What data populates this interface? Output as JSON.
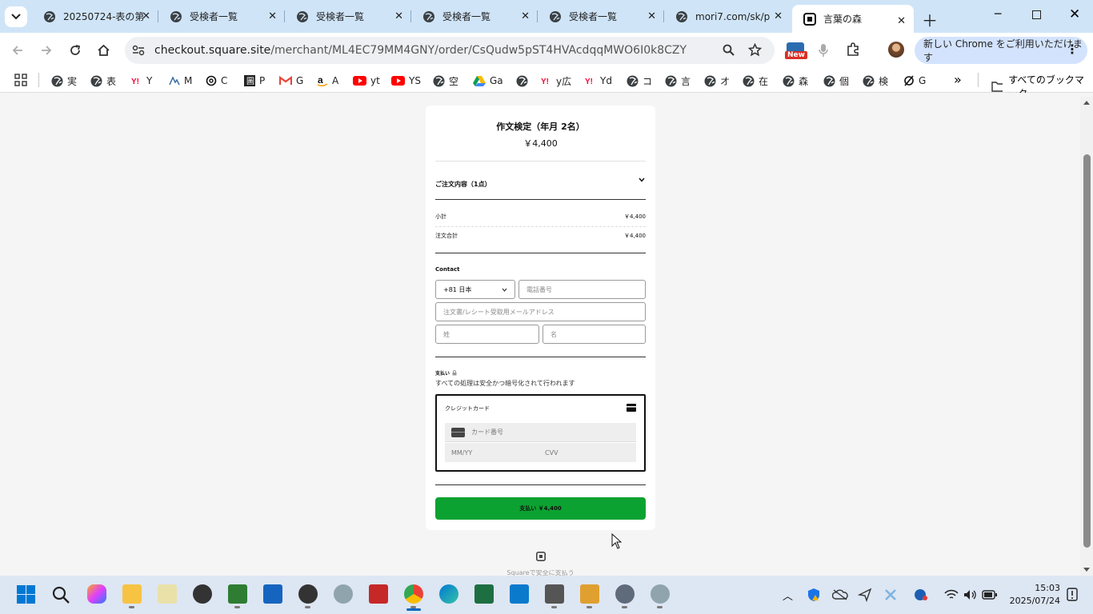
{
  "tabs": [
    {
      "title": "20250724-表の第",
      "active": false
    },
    {
      "title": "受検者一覧",
      "active": false
    },
    {
      "title": "受検者一覧",
      "active": false
    },
    {
      "title": "受検者一覧",
      "active": false
    },
    {
      "title": "受検者一覧",
      "active": false
    },
    {
      "title": "mori7.com/sk/p",
      "active": false
    },
    {
      "title": "言葉の森",
      "active": true
    }
  ],
  "address": {
    "host": "checkout.square.site",
    "path": "/merchant/ML4EC79MM4GNY/order/CsQudw5pST4HVAcdqqMWO6I0k8CZY"
  },
  "new_badge": "New",
  "update_button": "新しい Chrome をご利用いただけます",
  "bookmarks": [
    "実",
    "表",
    "Y",
    "M",
    "C",
    "P",
    "G",
    "A",
    "yt",
    "YS",
    "空",
    "Ga",
    "",
    "y広",
    "Yd",
    "コ",
    "言",
    "オ",
    "在",
    "森",
    "個",
    "検",
    "G"
  ],
  "all_bookmarks": "すべてのブックマーク",
  "checkout": {
    "product_title": "作文検定（年月 2名）",
    "product_price": "￥4,400",
    "order_summary": "ご注文内容（1点）",
    "subtotal_label": "小計",
    "subtotal_value": "￥4,400",
    "total_label": "注文合計",
    "total_value": "￥4,400",
    "contact_label": "Contact",
    "country_code": "+81 日本",
    "phone_placeholder": "電話番号",
    "email_placeholder": "注文書/レシート受取用メールアドレス",
    "last_name_placeholder": "姓",
    "first_name_placeholder": "名",
    "payment_label": "支払い",
    "secure_note": "すべての処理は安全かつ暗号化されて行われます",
    "credit_card_label": "クレジットカード",
    "card_number_placeholder": "カード番号",
    "expiry_placeholder": "MM/YY",
    "cvv_placeholder": "CVV",
    "pay_button": "支払い ￥4,400",
    "footer_text": "Squareで安全に支払う"
  },
  "clock": {
    "time": "15:03",
    "date": "2025/07/24"
  },
  "colors": {
    "pay_green": "#0ca231",
    "tab_bg": "#cfe4f7",
    "taskbar": "#dde6f3"
  }
}
